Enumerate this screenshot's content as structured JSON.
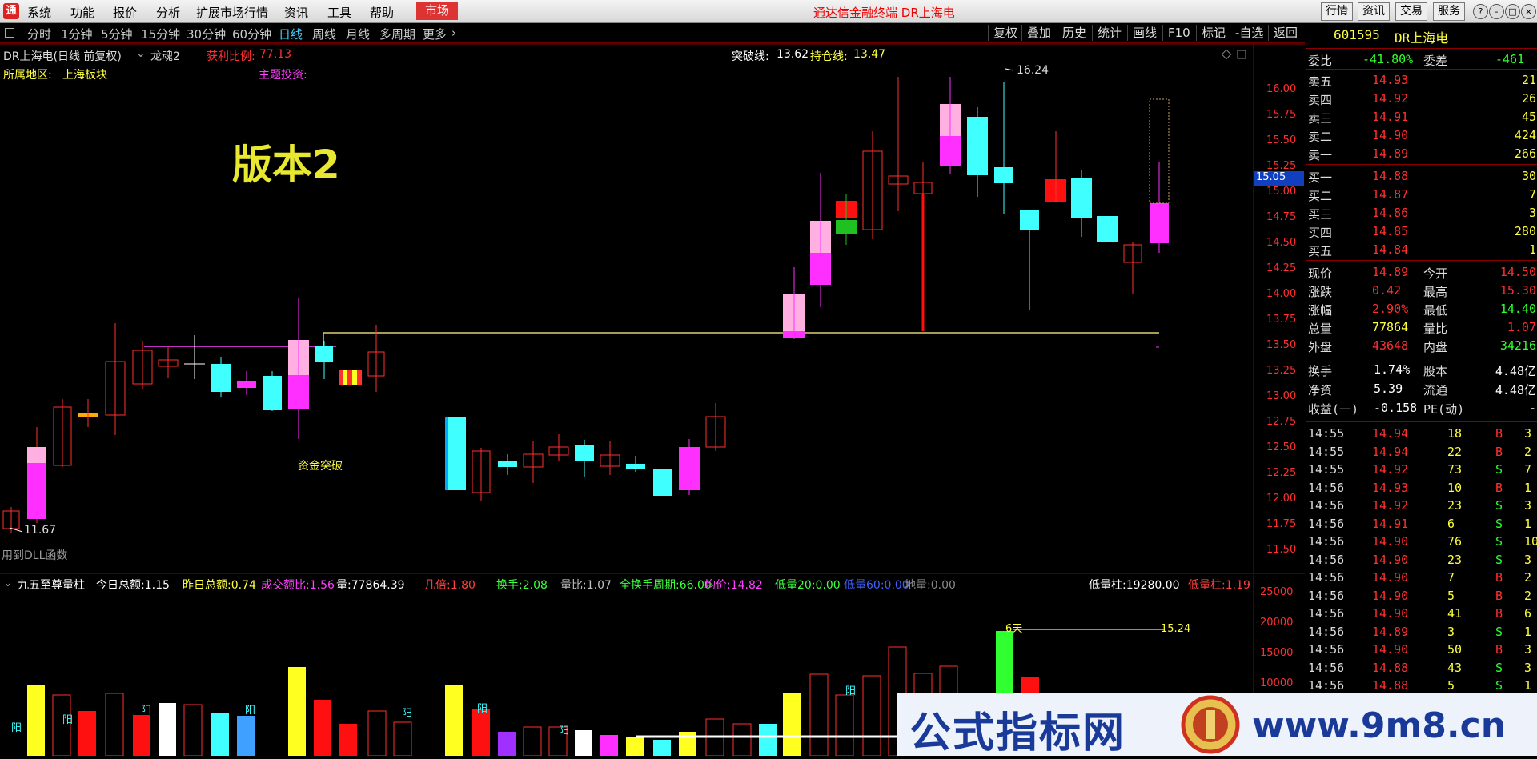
{
  "menu": {
    "logo": "通",
    "items": [
      "系统",
      "功能",
      "报价",
      "分析",
      "扩展市场行情",
      "资讯",
      "工具",
      "帮助"
    ],
    "market": "市场",
    "window_title": "通达信金融终端 DR上海电",
    "right_buttons": [
      "行情",
      "资讯",
      "交易",
      "服务"
    ],
    "window_buttons": [
      "?",
      "-",
      "□",
      "×"
    ]
  },
  "periods": {
    "items": [
      "分时",
      "1分钟",
      "5分钟",
      "15分钟",
      "30分钟",
      "60分钟",
      "日线",
      "周线",
      "月线",
      "多周期",
      "更多"
    ],
    "active": "日线",
    "toolbar": [
      "复权",
      "叠加",
      "历史",
      "统计",
      "画线",
      "F10",
      "标记",
      "-自选",
      "返回"
    ]
  },
  "chart_header": {
    "stock_label": "DR上海电(日线 前复权)",
    "formula": "龙魂2",
    "profit_label": "获利比例:",
    "profit_value": "77.13",
    "breakout_label": "突破线:",
    "breakout_value": "13.62",
    "hold_label": "持仓线:",
    "hold_value": "13.47",
    "region_label": "所属地区:",
    "region_value": "上海板块",
    "theme_label": "主题投资:",
    "version_text": "版本2",
    "fund_break": "资金突破",
    "dll_note": "用到DLL函数",
    "low_label": "11.67",
    "high_label": "16.24",
    "price_marker": "15.05"
  },
  "sub_header": {
    "name": "九五至尊量柱",
    "items": [
      {
        "label": "今日总额:",
        "value": "1.15",
        "lc": "#ffffff",
        "vc": "#ffffff"
      },
      {
        "label": "昨日总额:",
        "value": "0.74",
        "lc": "#ffff40",
        "vc": "#ffff40"
      },
      {
        "label": "成交额比:",
        "value": "1.56",
        "lc": "#ff40ff",
        "vc": "#ff40ff"
      },
      {
        "label": "量:",
        "value": "77864.39",
        "lc": "#ffffff",
        "vc": "#ffffff"
      },
      {
        "label": "几倍:",
        "value": "1.80",
        "lc": "#ff4040",
        "vc": "#ff4040"
      },
      {
        "label": "换手:",
        "value": "2.08",
        "lc": "#40ff40",
        "vc": "#40ff40"
      },
      {
        "label": "量比:",
        "value": "1.07",
        "lc": "#c0c0c0",
        "vc": "#c0c0c0"
      },
      {
        "label": "全换手周期:",
        "value": "66.00",
        "lc": "#40ff40",
        "vc": "#40ff40"
      },
      {
        "label": "均价:",
        "value": "14.82",
        "lc": "#ff40ff",
        "vc": "#ff40ff"
      },
      {
        "label": "低量20:",
        "value": "0.00",
        "lc": "#40ff40",
        "vc": "#40ff40"
      },
      {
        "label": "低量60:",
        "value": "0.00",
        "lc": "#4060ff",
        "vc": "#4060ff"
      },
      {
        "label": "地量:",
        "value": "0.00",
        "lc": "#888888",
        "vc": "#888888"
      },
      {
        "label": "低量柱:",
        "value": "19280.00",
        "lc": "#ffffff",
        "vc": "#ffffff"
      },
      {
        "label": "低量柱:",
        "value": "1.19",
        "lc": "#ff4040",
        "vc": "#ff4040"
      }
    ],
    "six_days": "6天",
    "vol_level": "15.24",
    "yang": "阳"
  },
  "axes": {
    "price_ticks": [
      "16.00",
      "15.75",
      "15.50",
      "15.25",
      "15.00",
      "14.75",
      "14.50",
      "14.25",
      "14.00",
      "13.75",
      "13.50",
      "13.25",
      "13.00",
      "12.75",
      "12.50",
      "12.25",
      "12.00",
      "11.75",
      "11.50"
    ],
    "volume_ticks": [
      "25000",
      "20000",
      "15000",
      "10000"
    ]
  },
  "quote": {
    "code": "601595",
    "name": "DR上海电",
    "wei_bi_label": "委比",
    "wei_bi_value": "-41.80%",
    "wei_cha_label": "委差",
    "wei_cha_value": "-461",
    "asks": [
      {
        "label": "卖五",
        "price": "14.93",
        "vol": "21"
      },
      {
        "label": "卖四",
        "price": "14.92",
        "vol": "26"
      },
      {
        "label": "卖三",
        "price": "14.91",
        "vol": "45"
      },
      {
        "label": "卖二",
        "price": "14.90",
        "vol": "424"
      },
      {
        "label": "卖一",
        "price": "14.89",
        "vol": "266"
      }
    ],
    "bids": [
      {
        "label": "买一",
        "price": "14.88",
        "vol": "30"
      },
      {
        "label": "买二",
        "price": "14.87",
        "vol": "7"
      },
      {
        "label": "买三",
        "price": "14.86",
        "vol": "3"
      },
      {
        "label": "买四",
        "price": "14.85",
        "vol": "280"
      },
      {
        "label": "买五",
        "price": "14.84",
        "vol": "1"
      }
    ],
    "stats": [
      {
        "l1": "现价",
        "v1": "14.89",
        "c1": "#ff3030",
        "l2": "今开",
        "v2": "14.50",
        "c2": "#ff3030"
      },
      {
        "l1": "涨跌",
        "v1": "0.42",
        "c1": "#ff3030",
        "l2": "最高",
        "v2": "15.30",
        "c2": "#ff3030"
      },
      {
        "l1": "涨幅",
        "v1": "2.90%",
        "c1": "#ff3030",
        "l2": "最低",
        "v2": "14.40",
        "c2": "#30ff30"
      },
      {
        "l1": "总量",
        "v1": "77864",
        "c1": "#ffff40",
        "l2": "量比",
        "v2": "1.07",
        "c2": "#ff3030"
      },
      {
        "l1": "外盘",
        "v1": "43648",
        "c1": "#ff3030",
        "l2": "内盘",
        "v2": "34216",
        "c2": "#30ff30"
      }
    ],
    "stats2": [
      {
        "l1": "换手",
        "v1": "1.74%",
        "c1": "#ffffff",
        "l2": "股本",
        "v2": "4.48亿",
        "c2": "#ffffff"
      },
      {
        "l1": "净资",
        "v1": "5.39",
        "c1": "#ffffff",
        "l2": "流通",
        "v2": "4.48亿",
        "c2": "#ffffff"
      },
      {
        "l1": "收益(一)",
        "v1": "-0.158",
        "c1": "#ffffff",
        "l2": "PE(动)",
        "v2": "-",
        "c2": "#ffffff"
      }
    ],
    "ticks": [
      {
        "t": "14:55",
        "p": "14.94",
        "v": "18",
        "bs": "B",
        "n": "3"
      },
      {
        "t": "14:55",
        "p": "14.94",
        "v": "22",
        "bs": "B",
        "n": "2"
      },
      {
        "t": "14:55",
        "p": "14.92",
        "v": "73",
        "bs": "S",
        "n": "7"
      },
      {
        "t": "14:56",
        "p": "14.93",
        "v": "10",
        "bs": "B",
        "n": "1"
      },
      {
        "t": "14:56",
        "p": "14.92",
        "v": "23",
        "bs": "S",
        "n": "3"
      },
      {
        "t": "14:56",
        "p": "14.91",
        "v": "6",
        "bs": "S",
        "n": "1"
      },
      {
        "t": "14:56",
        "p": "14.90",
        "v": "76",
        "bs": "S",
        "n": "10"
      },
      {
        "t": "14:56",
        "p": "14.90",
        "v": "23",
        "bs": "S",
        "n": "3"
      },
      {
        "t": "14:56",
        "p": "14.90",
        "v": "7",
        "bs": "B",
        "n": "2"
      },
      {
        "t": "14:56",
        "p": "14.90",
        "v": "5",
        "bs": "B",
        "n": "2"
      },
      {
        "t": "14:56",
        "p": "14.90",
        "v": "41",
        "bs": "B",
        "n": "6"
      },
      {
        "t": "14:56",
        "p": "14.89",
        "v": "3",
        "bs": "S",
        "n": "1"
      },
      {
        "t": "14:56",
        "p": "14.90",
        "v": "50",
        "bs": "B",
        "n": "3"
      },
      {
        "t": "14:56",
        "p": "14.88",
        "v": "43",
        "bs": "S",
        "n": "3"
      },
      {
        "t": "14:56",
        "p": "14.88",
        "v": "5",
        "bs": "S",
        "n": "1"
      }
    ]
  },
  "watermark": {
    "text": "公式指标网",
    "url": "www.9m8.cn"
  },
  "colors": {
    "up": "#ff3030",
    "down": "#40ffff",
    "magenta": "#ff30ff",
    "pink": "#ffb0e0",
    "yellow": "#ffff20",
    "grid_red": "#8a0000"
  }
}
